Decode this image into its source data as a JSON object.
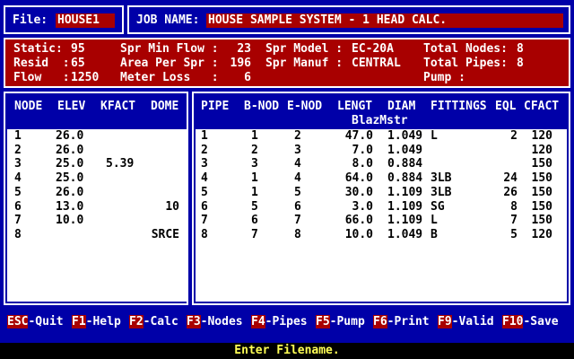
{
  "header": {
    "file_label": "File:",
    "file_value": "HOUSE1",
    "job_label": "JOB NAME:",
    "job_value": "HOUSE SAMPLE SYSTEM - 1 HEAD CALC."
  },
  "params": {
    "static_label": "Static:",
    "static_value": "95",
    "resid_label": "Resid  :",
    "resid_value": "65",
    "flow_label": "Flow   :",
    "flow_value": "1250",
    "spr_min_flow_label": "Spr Min Flow :",
    "spr_min_flow_value": "23",
    "area_per_spr_label": "Area Per Spr :",
    "area_per_spr_value": "196",
    "meter_loss_label": "Meter Loss   :",
    "meter_loss_value": "6",
    "spr_model_label": "Spr Model :",
    "spr_model_value": "EC-20A",
    "spr_manuf_label": "Spr Manuf :",
    "spr_manuf_value": "CENTRAL",
    "total_nodes_label": "Total Nodes:",
    "total_nodes_value": "8",
    "total_pipes_label": "Total Pipes:",
    "total_pipes_value": "8",
    "pump_label": "Pump :",
    "pump_value": ""
  },
  "nodes": {
    "headers": [
      "NODE",
      "ELEV",
      "KFACT",
      "DOME"
    ],
    "rows": [
      [
        "1",
        "26.0",
        "",
        ""
      ],
      [
        "2",
        "26.0",
        "",
        ""
      ],
      [
        "3",
        "25.0",
        "5.39",
        ""
      ],
      [
        "4",
        "25.0",
        "",
        ""
      ],
      [
        "5",
        "26.0",
        "",
        ""
      ],
      [
        "6",
        "13.0",
        "",
        "10"
      ],
      [
        "7",
        "10.0",
        "",
        ""
      ],
      [
        "8",
        "",
        "",
        "SRCE"
      ]
    ]
  },
  "pipes": {
    "headers": [
      "PIPE",
      "B-NOD",
      "E-NOD",
      "LENGT",
      "DIAM",
      "FITTINGS",
      "EQL",
      "CFACT"
    ],
    "subtitle": "BlazMstr",
    "rows": [
      [
        "1",
        "1",
        "2",
        "47.0",
        "1.049",
        "L",
        "2",
        "120"
      ],
      [
        "2",
        "2",
        "3",
        "7.0",
        "1.049",
        "",
        "",
        "120"
      ],
      [
        "3",
        "3",
        "4",
        "8.0",
        "0.884",
        "",
        "",
        "150"
      ],
      [
        "4",
        "1",
        "4",
        "64.0",
        "0.884",
        "3LB",
        "24",
        "150"
      ],
      [
        "5",
        "1",
        "5",
        "30.0",
        "1.109",
        "3LB",
        "26",
        "150"
      ],
      [
        "6",
        "5",
        "6",
        "3.0",
        "1.109",
        "SG",
        "8",
        "150"
      ],
      [
        "7",
        "6",
        "7",
        "66.0",
        "1.109",
        "L",
        "7",
        "150"
      ],
      [
        "8",
        "7",
        "8",
        "10.0",
        "1.049",
        "B",
        "5",
        "120"
      ]
    ]
  },
  "keys": [
    {
      "key": "ESC",
      "label": "-Quit"
    },
    {
      "key": "F1",
      "label": "-Help"
    },
    {
      "key": "F2",
      "label": "-Calc"
    },
    {
      "key": "F3",
      "label": "-Nodes"
    },
    {
      "key": "F4",
      "label": "-Pipes"
    },
    {
      "key": "F5",
      "label": "-Pump"
    },
    {
      "key": "F6",
      "label": "-Print"
    },
    {
      "key": "F9",
      "label": "-Valid"
    },
    {
      "key": "F10",
      "label": "-Save"
    }
  ],
  "status": "Enter Filename.",
  "colors": {
    "background": "#0000a8",
    "highlight": "#a80000",
    "status_text": "#ffff55"
  }
}
